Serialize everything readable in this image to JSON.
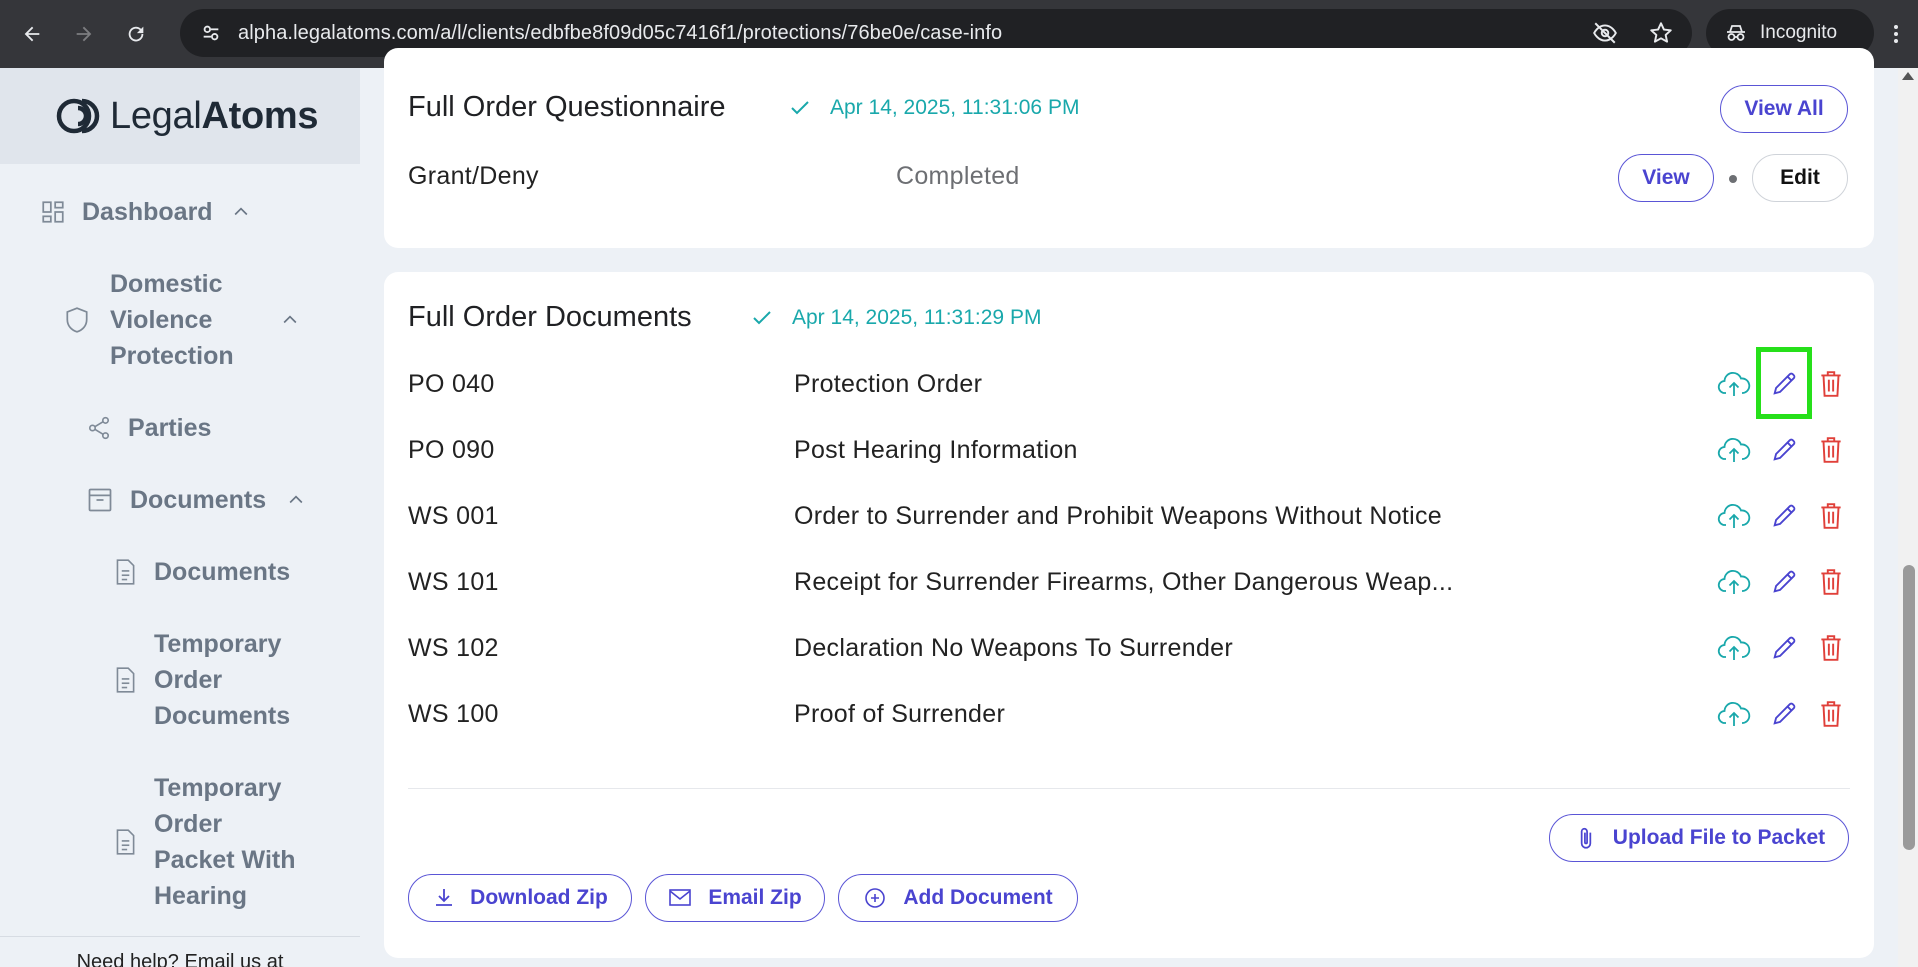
{
  "browser": {
    "url": "alpha.legalatoms.com/a/l/clients/edbfbe8f09d05c7416f1/protections/76be0e/case-info",
    "incognito_label": "Incognito"
  },
  "sidebar": {
    "logo_light": "Legal",
    "logo_bold": "Atoms",
    "items": [
      {
        "label": "Dashboard",
        "icon": "dashboard-icon"
      },
      {
        "label_lines": [
          "Domestic",
          "Violence",
          "Protection"
        ],
        "icon": "shield-icon"
      },
      {
        "label": "Parties",
        "icon": "share-icon"
      },
      {
        "label": "Documents",
        "icon": "archive-icon"
      },
      {
        "label": "Documents",
        "icon": "file-icon"
      },
      {
        "label_lines": [
          "Temporary",
          "Order",
          "Documents"
        ],
        "icon": "file-icon"
      },
      {
        "label_lines": [
          "Temporary",
          "Order",
          "Packet With",
          "Hearing"
        ],
        "icon": "file-icon"
      }
    ],
    "help_text": "Need help? Email us at"
  },
  "questionnaire": {
    "title": "Full Order Questionnaire",
    "timestamp": "Apr 14, 2025, 11:31:06 PM",
    "view_all_label": "View All",
    "row": {
      "name": "Grant/Deny",
      "status": "Completed",
      "view_label": "View",
      "edit_label": "Edit"
    }
  },
  "documents": {
    "title": "Full Order Documents",
    "timestamp": "Apr 14, 2025, 11:31:29 PM",
    "rows": [
      {
        "code": "PO 040",
        "name": "Protection Order"
      },
      {
        "code": "PO 090",
        "name": "Post Hearing Information"
      },
      {
        "code": "WS 001",
        "name": "Order to Surrender and Prohibit Weapons Without Notice"
      },
      {
        "code": "WS 101",
        "name": "Receipt for Surrender Firearms, Other Dangerous Weap..."
      },
      {
        "code": "WS 102",
        "name": "Declaration No Weapons To Surrender"
      },
      {
        "code": "WS 100",
        "name": "Proof of Surrender"
      }
    ],
    "upload_label": "Upload File to Packet",
    "download_zip_label": "Download Zip",
    "email_zip_label": "Email Zip",
    "add_document_label": "Add Document"
  },
  "colors": {
    "accent": "#4a44d0",
    "teal": "#19a8ab",
    "danger": "#e0403a",
    "highlight": "#26e01a"
  }
}
